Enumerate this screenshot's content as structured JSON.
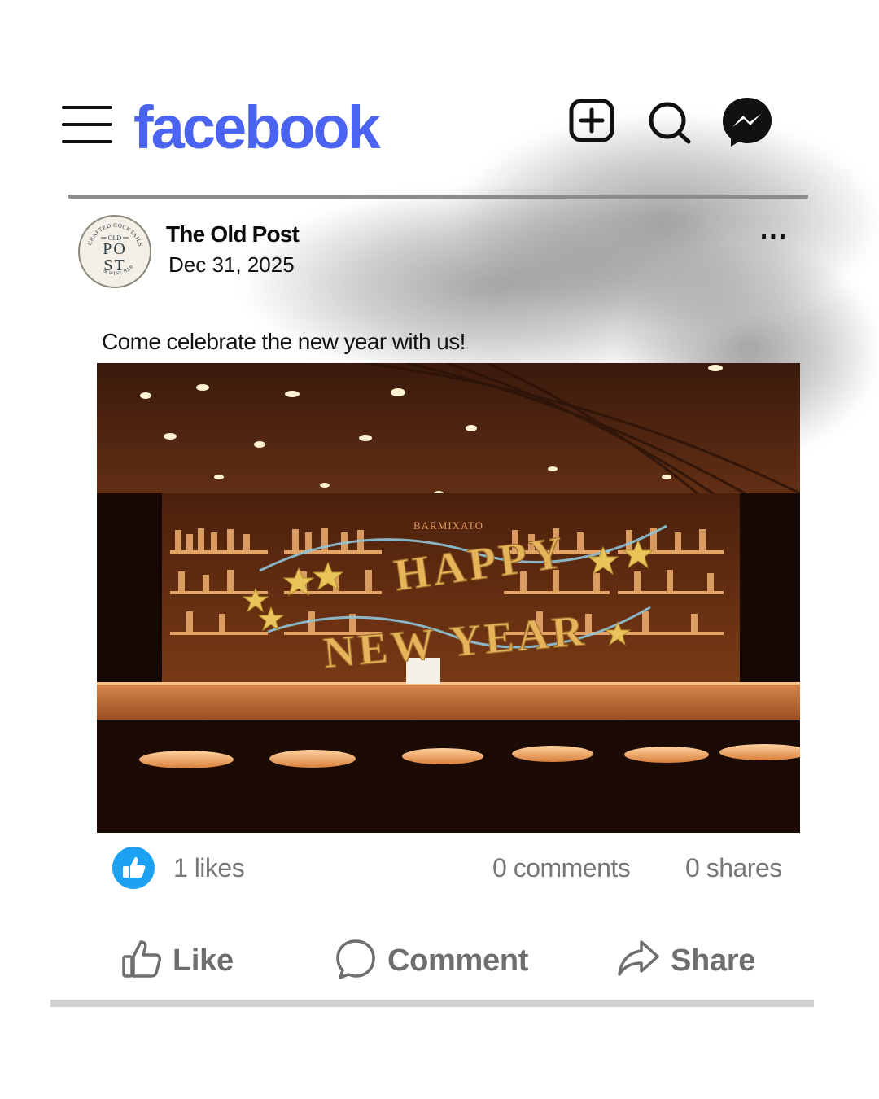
{
  "app": {
    "logo_text": "facebook",
    "brand_color": "#4a63f0"
  },
  "header": {
    "menu_icon": "hamburger-menu-icon",
    "create_icon": "add-square-icon",
    "search_icon": "search-icon",
    "messenger_icon": "messenger-icon"
  },
  "post": {
    "page_name": "The Old Post",
    "date": "Dec 31, 2025",
    "more_label": "...",
    "caption": "Come celebrate the new year with us!",
    "avatar": {
      "logo_top": "CRAFTED COCKTAILS",
      "logo_old": "OLD",
      "logo_po": "PO",
      "logo_st": "ST",
      "logo_bottom": "& WINE BAR"
    },
    "image": {
      "bar_sign": "BARMIXATO",
      "banner_line1": "HAPPY",
      "banner_line2": "NEW YEAR"
    }
  },
  "stats": {
    "likes": "1 likes",
    "comments": "0 comments",
    "shares": "0 shares",
    "like_badge_color": "#1da1f2"
  },
  "actions": {
    "like": "Like",
    "comment": "Comment",
    "share": "Share"
  }
}
